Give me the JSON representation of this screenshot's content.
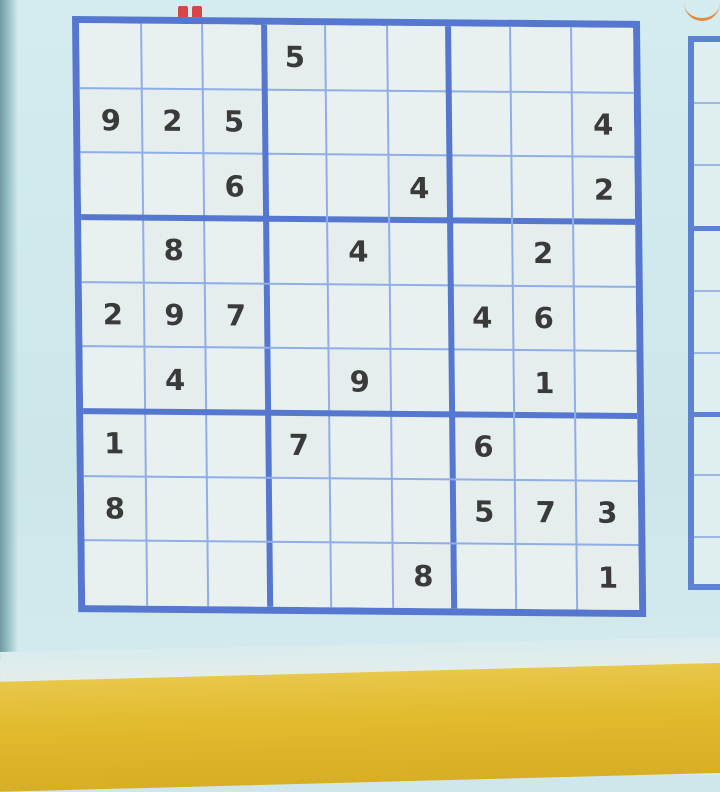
{
  "puzzle": {
    "grid": [
      [
        "",
        "",
        "",
        "5",
        "",
        "",
        "",
        "",
        ""
      ],
      [
        "9",
        "2",
        "5",
        "",
        "",
        "",
        "",
        "",
        "4"
      ],
      [
        "",
        "",
        "6",
        "",
        "",
        "4",
        "",
        "",
        "2"
      ],
      [
        "",
        "8",
        "",
        "",
        "4",
        "",
        "",
        "2",
        ""
      ],
      [
        "2",
        "9",
        "7",
        "",
        "",
        "",
        "4",
        "6",
        ""
      ],
      [
        "",
        "4",
        "",
        "",
        "9",
        "",
        "",
        "1",
        ""
      ],
      [
        "1",
        "",
        "",
        "7",
        "",
        "",
        "6",
        "",
        ""
      ],
      [
        "8",
        "",
        "",
        "",
        "",
        "",
        "5",
        "7",
        "3"
      ],
      [
        "",
        "",
        "",
        "",
        "",
        "8",
        "",
        "",
        "1"
      ]
    ]
  },
  "colors": {
    "grid_thick": "#5577cf",
    "grid_thin": "#8faee6",
    "digit": "#3a3a3a",
    "cell": "#e9f0f0",
    "page": "#cfe6ea",
    "band": "#e2bb2f"
  }
}
